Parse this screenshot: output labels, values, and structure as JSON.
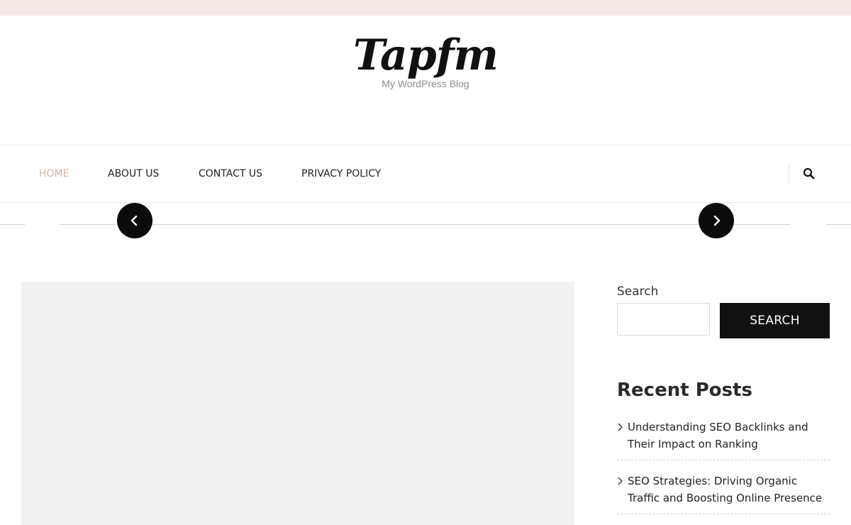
{
  "header": {
    "site_title": "Tapfm",
    "tagline": "My WordPress Blog"
  },
  "nav": {
    "items": [
      {
        "label": "HOME",
        "active": true
      },
      {
        "label": "ABOUT US",
        "active": false
      },
      {
        "label": "CONTACT US",
        "active": false
      },
      {
        "label": "PRIVACY POLICY",
        "active": false
      }
    ],
    "search_icon": "search-icon"
  },
  "slider": {
    "prev_icon": "chevron-left-icon",
    "next_icon": "chevron-right-icon"
  },
  "sidebar": {
    "search": {
      "label": "Search",
      "value": "",
      "button_label": "SEARCH"
    },
    "recent_posts": {
      "title": "Recent Posts",
      "items": [
        {
          "title": "Understanding SEO Backlinks and Their Impact on Ranking"
        },
        {
          "title": "SEO Strategies: Driving Organic Traffic and Boosting Online Presence"
        }
      ]
    }
  },
  "colors": {
    "topbar": "#f5e9e8",
    "nav_active": "#d3b3a9",
    "accent_dark": "#111111",
    "placeholder": "#f1f1f1"
  }
}
